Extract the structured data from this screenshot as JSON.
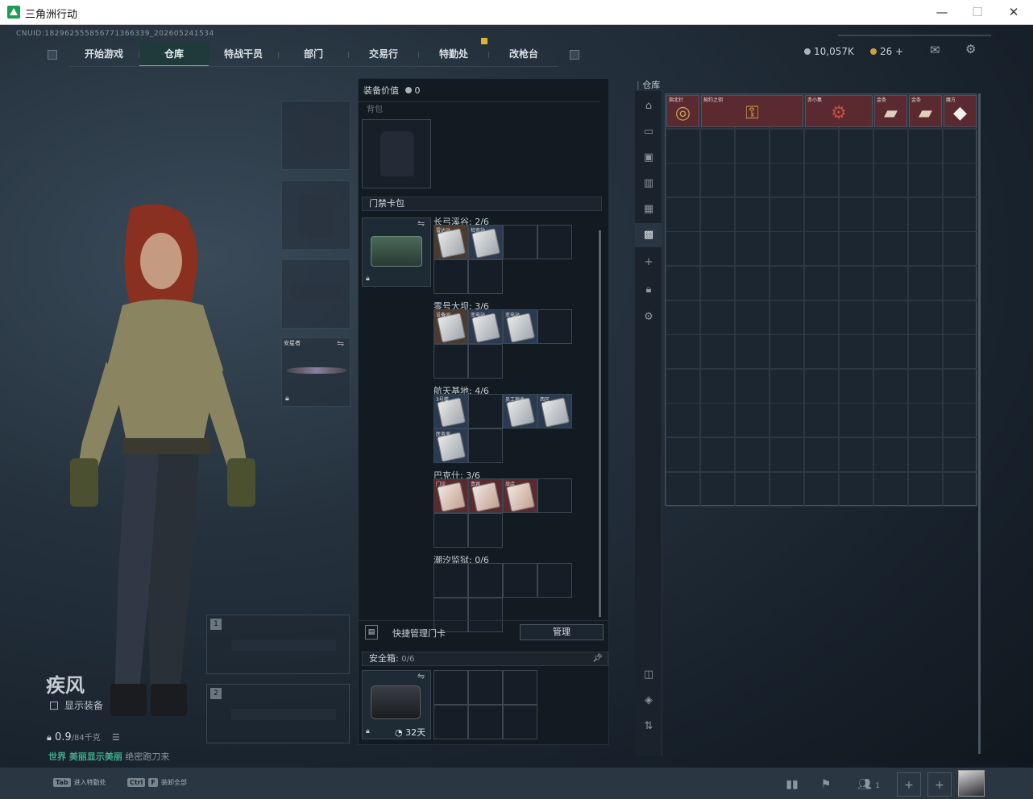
{
  "window": {
    "title": "三角洲行动",
    "minimize": "—",
    "maximize": "☐",
    "close": "✕"
  },
  "uid": "CNUID:182962555856771366339_202605241534",
  "nav": {
    "items": [
      {
        "label": "开始游戏"
      },
      {
        "label": "仓库",
        "active": true
      },
      {
        "label": "特战干员"
      },
      {
        "label": "部门"
      },
      {
        "label": "交易行"
      },
      {
        "label": "特勤处"
      },
      {
        "label": "改枪台"
      }
    ]
  },
  "currency": {
    "coins": "10,057K",
    "tickets": "26",
    "add": "+"
  },
  "character": {
    "name": "疾风",
    "show_equip": "显示装备",
    "weight_value": "0.9",
    "weight_max": "/84千克",
    "status_green": "世界 美丽显示美丽",
    "status_grey": "绝密跑刀来"
  },
  "loadout": {
    "melee_label": "安星者",
    "weapon_slot1": "1",
    "weapon_slot2": "2"
  },
  "middle": {
    "equip_value_label": "装备价值",
    "equip_value": "0",
    "backpack_label": "背包",
    "keycard_pack_label": "门禁卡包",
    "maps": [
      {
        "title": "长弓溪谷: 2/6",
        "cards": [
          {
            "label": "雷达站",
            "bg": "brown"
          },
          {
            "label": "检查站",
            "bg": "blue"
          }
        ]
      },
      {
        "title": "零号大坝: 3/6",
        "cards": [
          {
            "label": "设备间",
            "bg": "brown"
          },
          {
            "label": "变电站",
            "bg": "blue"
          },
          {
            "label": "变电站",
            "bg": "blue"
          }
        ]
      },
      {
        "title": "航天基地: 4/6",
        "cards": [
          {
            "label": "3号楼",
            "bg": "blue"
          },
          {
            "label": "",
            "bg": "none"
          },
          {
            "label": "员工宿舍",
            "bg": "blue"
          },
          {
            "label": "西区",
            "bg": "blue"
          },
          {
            "label": "医务室",
            "bg": "blue"
          }
        ]
      },
      {
        "title": "巴克什: 3/6",
        "cards": [
          {
            "label": "门诊",
            "bg": "red"
          },
          {
            "label": "贵宾",
            "bg": "red"
          },
          {
            "label": "旅店",
            "bg": "red"
          }
        ]
      },
      {
        "title": "潮汐监狱: 0/6",
        "cards": []
      }
    ],
    "quick_manage_label": "快捷管理门卡",
    "manage_button": "管理",
    "safebox_label": "安全箱:",
    "safebox_count": "0/6",
    "safebox_timer": "32天"
  },
  "warehouse": {
    "title": "仓库",
    "items": [
      {
        "label": "指北针",
        "span": 1,
        "bg": "#5a2a30",
        "glyph": "◎",
        "color": "#c8a050"
      },
      {
        "label": "契约之钥",
        "span": 3,
        "bg": "#5a2a30",
        "glyph": "⚿",
        "color": "#d4a040"
      },
      {
        "label": "赤小集",
        "span": 2,
        "bg": "#5a2a30",
        "glyph": "⚙",
        "color": "#c05040"
      },
      {
        "label": "金条",
        "span": 1,
        "bg": "#5a2a30",
        "glyph": "▰",
        "color": "#e0d0c0"
      },
      {
        "label": "金条",
        "span": 1,
        "bg": "#5a2a30",
        "glyph": "▰",
        "color": "#e0d0c0"
      },
      {
        "label": "魔方",
        "span": 1,
        "bg": "#5a2a30",
        "glyph": "◆",
        "color": "#f0f0f0"
      }
    ]
  },
  "bottom": {
    "tab_key": "Tab",
    "tab_text": "进入特勤处",
    "ctrl_key": "Ctrl",
    "f_key": "F",
    "ctrl_text": "装卸全部",
    "friends_count": "1"
  },
  "colors": {
    "accent": "#2fd0a0",
    "panel": "#121a22",
    "grid": "#1c2630"
  }
}
